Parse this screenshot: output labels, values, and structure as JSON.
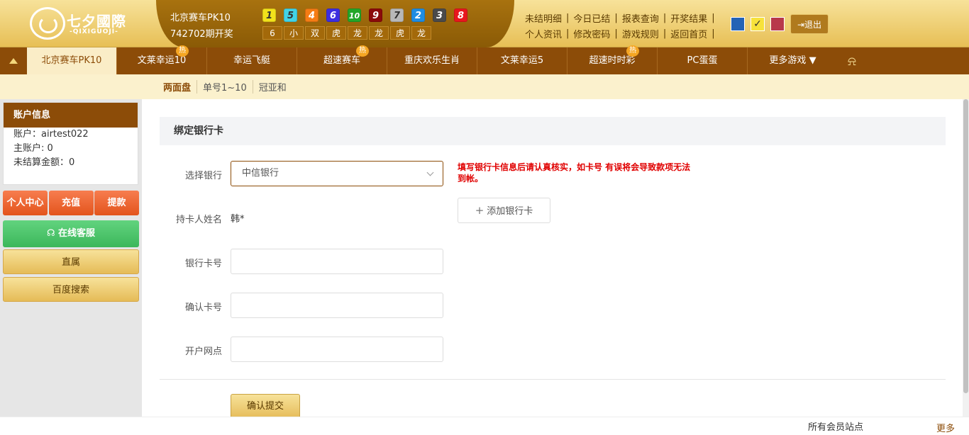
{
  "header": {
    "logo_text": "七夕國際",
    "logo_sub": "-QIXIGUOJI-",
    "lottery_name": "北京赛车PK10",
    "issue": "742702期开奖",
    "balls": [
      {
        "num": "1",
        "color": "#f2e21b",
        "text": "#333"
      },
      {
        "num": "5",
        "color": "#42d3e6",
        "text": "#333"
      },
      {
        "num": "4",
        "color": "#f57c14",
        "text": "#fff"
      },
      {
        "num": "6",
        "color": "#3d2ee0",
        "text": "#fff"
      },
      {
        "num": "10",
        "color": "#23a629",
        "text": "#fff"
      },
      {
        "num": "9",
        "color": "#8b0a0a",
        "text": "#fff"
      },
      {
        "num": "7",
        "color": "#b8b8b8",
        "text": "#333"
      },
      {
        "num": "2",
        "color": "#1f8de3",
        "text": "#fff"
      },
      {
        "num": "3",
        "color": "#4a4a4a",
        "text": "#fff"
      },
      {
        "num": "8",
        "color": "#e8171d",
        "text": "#fff"
      }
    ],
    "tags": [
      "6",
      "小",
      "双",
      "虎",
      "龙",
      "龙",
      "虎",
      "龙"
    ],
    "links_row1": [
      "未结明细",
      "今日已结",
      "报表查询",
      "开奖结果"
    ],
    "links_row2": [
      "个人资讯",
      "修改密码",
      "游戏规则",
      "返回首页"
    ],
    "themes": [
      {
        "color": "#2463b5"
      },
      {
        "color": "#f7e23b",
        "selected": "✓"
      },
      {
        "color": "#b8384a"
      }
    ],
    "logout": "退出"
  },
  "nav": {
    "items": [
      {
        "label": "北京赛车PK10",
        "active": true,
        "hot": false
      },
      {
        "label": "文莱幸运10",
        "active": false,
        "hot": true
      },
      {
        "label": "幸运飞艇",
        "active": false,
        "hot": false
      },
      {
        "label": "超速赛车",
        "active": false,
        "hot": true
      },
      {
        "label": "重庆欢乐生肖",
        "active": false,
        "hot": false
      },
      {
        "label": "文莱幸运5",
        "active": false,
        "hot": false
      },
      {
        "label": "超速时时彩",
        "active": false,
        "hot": true
      },
      {
        "label": "PC蛋蛋",
        "active": false,
        "hot": false
      }
    ],
    "hot_label": "热",
    "more_label": "更多游戏",
    "more_arrow": "▼"
  },
  "subnav": {
    "items": [
      "两面盘",
      "单号1~10",
      "冠亚和"
    ]
  },
  "sidebar": {
    "account_title": "账户信息",
    "account_line": "账户：airtest022",
    "main_account": "主账户: 0",
    "unsettled": "未结算金额：0",
    "btn_center": "个人中心",
    "btn_recharge": "充值",
    "btn_withdraw": "提款",
    "btn_service": "在线客服",
    "btn_direct": "直属",
    "btn_baidu": "百度搜索"
  },
  "form": {
    "title": "绑定银行卡",
    "label_bank": "选择银行",
    "bank_value": "中信银行",
    "warning": "填写银行卡信息后请认真核实，如卡号 有误将会导致款项无法到帐。",
    "label_holder": "持卡人姓名",
    "holder_value": "韩*",
    "add_card": "添加银行卡",
    "label_card": "银行卡号",
    "label_confirm": "确认卡号",
    "label_branch": "开户网点",
    "card_value": "",
    "confirm_value": "",
    "branch_value": "",
    "submit": "确认提交"
  },
  "footer": {
    "sites": "所有会员站点",
    "more": "更多"
  }
}
